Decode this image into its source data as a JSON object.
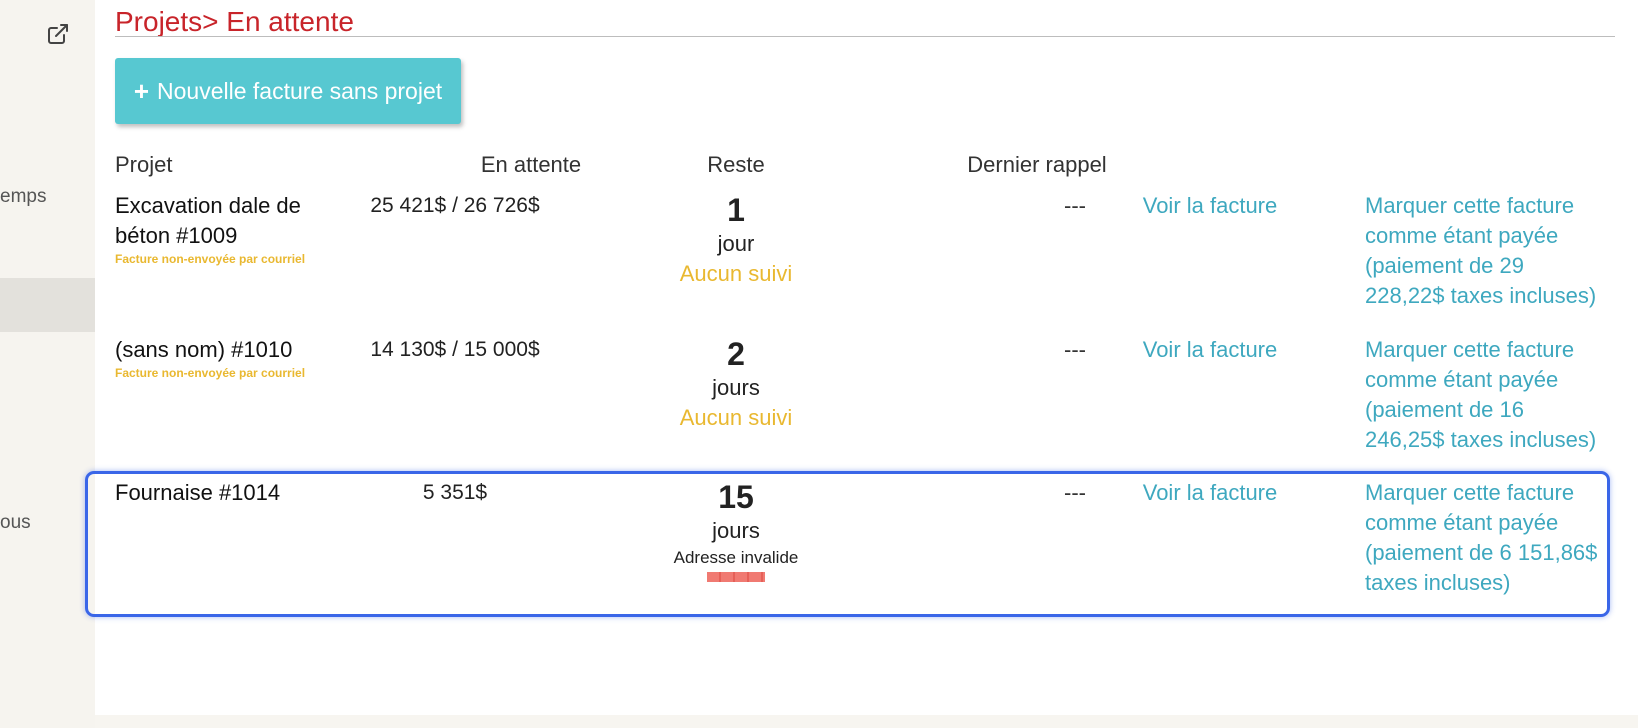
{
  "sidebar": {
    "external_link_icon": "external-link-icon",
    "fragment_1": "emps",
    "fragment_2": "ous"
  },
  "page": {
    "title": "Projets> En attente",
    "title_color": "#c8242a"
  },
  "toolbar": {
    "new_invoice_label": "Nouvelle facture sans projet",
    "new_invoice_icon": "plus-icon",
    "button_color": "#57c8d1"
  },
  "table": {
    "headers": {
      "project": "Projet",
      "pending": "En attente",
      "remaining": "Reste",
      "last_reminder": "Dernier rappel"
    },
    "rows": [
      {
        "project": "Excavation dale de béton #1009",
        "warning": "Facture non-envoyée par courriel",
        "amount": "25 421$ / 26 726$",
        "remaining_value": "1",
        "remaining_unit": "jour",
        "status": "Aucun suivi",
        "last_reminder": "---",
        "view_link": "Voir la facture",
        "mark_paid_link": "Marquer cette facture comme étant payée (paiement de 29 228,22$ taxes incluses)"
      },
      {
        "project": "(sans nom) #1010",
        "warning": "Facture non-envoyée par courriel",
        "amount": "14 130$ / 15 000$",
        "remaining_value": "2",
        "remaining_unit": "jours",
        "status": "Aucun suivi",
        "last_reminder": "---",
        "view_link": "Voir la facture",
        "mark_paid_link": "Marquer cette facture comme étant payée (paiement de 16 246,25$ taxes incluses)"
      },
      {
        "project": "Fournaise #1014",
        "warning": "",
        "amount": "5 351$",
        "remaining_value": "15",
        "remaining_unit": "jours",
        "status": "Adresse invalide",
        "last_reminder": "---",
        "view_link": "Voir la facture",
        "mark_paid_link": "Marquer cette facture comme étant payée (paiement de 6 151,86$ taxes incluses)",
        "highlighted": true
      }
    ]
  },
  "colors": {
    "link": "#3ea8bf",
    "warning": "#e9b830",
    "highlight_border": "#3a66e8",
    "invalid_bar": "#f07a72"
  }
}
